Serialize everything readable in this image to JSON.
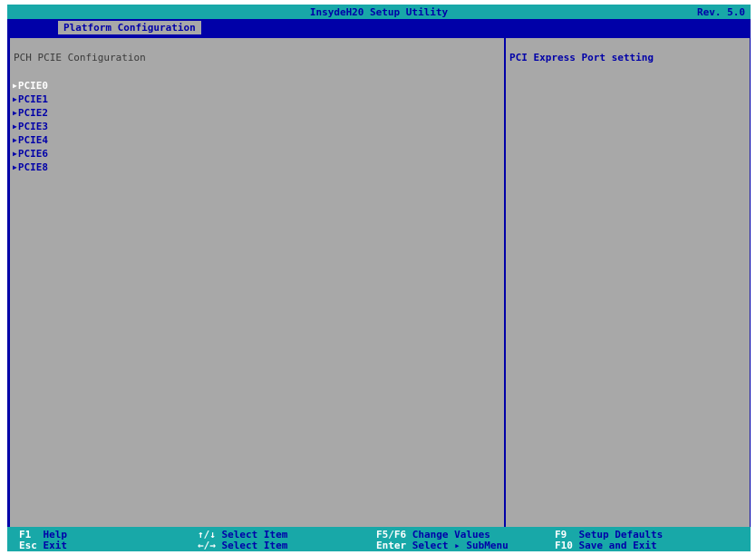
{
  "header": {
    "title": "InsydeH20 Setup Utility",
    "revision": "Rev. 5.0"
  },
  "tabs": [
    {
      "label": "Platform Configuration",
      "active": true
    }
  ],
  "main": {
    "section_title": "PCH PCIE Configuration",
    "items": [
      {
        "label": "PCIE0",
        "selected": true
      },
      {
        "label": "PCIE1",
        "selected": false
      },
      {
        "label": "PCIE2",
        "selected": false
      },
      {
        "label": "PCIE3",
        "selected": false
      },
      {
        "label": "PCIE4",
        "selected": false
      },
      {
        "label": "PCIE6",
        "selected": false
      },
      {
        "label": "PCIE8",
        "selected": false
      }
    ]
  },
  "help": {
    "text": "PCI Express Port setting"
  },
  "footer": {
    "f1_key": "F1",
    "f1_label": "Help",
    "esc_key": "Esc",
    "esc_label": "Exit",
    "updown_key": "↑/↓",
    "updown_label": "Select Item",
    "leftright_key": "←/→",
    "leftright_label": "Select Item",
    "f5f6_key": "F5/F6",
    "f5f6_label": "Change Values",
    "enter_key": "Enter",
    "enter_label": "Select ▸ SubMenu",
    "f9_key": "F9",
    "f9_label": "Setup Defaults",
    "f10_key": "F10",
    "f10_label": "Save and Exit"
  },
  "colors": {
    "bios_blue": "#0000a8",
    "bios_gray": "#a8a8a8",
    "bios_cyan": "#18a8a8",
    "highlight_white": "#ffffff"
  },
  "icons": {
    "submenu_arrow": "▶"
  }
}
